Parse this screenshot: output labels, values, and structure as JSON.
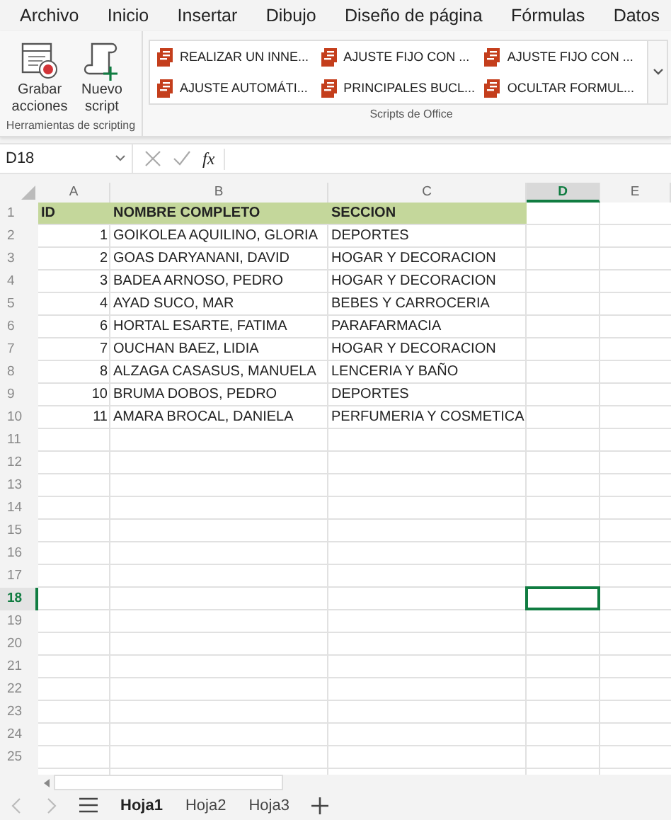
{
  "menu_tabs": [
    "Archivo",
    "Inicio",
    "Insertar",
    "Dibujo",
    "Diseño de página",
    "Fórmulas",
    "Datos"
  ],
  "ribbon": {
    "groups": [
      {
        "kind": "tools",
        "label": "Herramientas de scripting",
        "buttons": [
          {
            "label": "Grabar acciones",
            "kind": "record"
          },
          {
            "label": "Nuevo script",
            "kind": "new"
          }
        ]
      },
      {
        "kind": "scripts",
        "label": "Scripts de Office",
        "scripts": [
          "REALIZAR UN INNE...",
          "AJUSTE FIJO CON ...",
          "AJUSTE FIJO CON ...",
          "AJUSTE AUTOMÁTI...",
          "PRINCIPALES BUCL...",
          "OCULTAR FORMUL..."
        ]
      }
    ]
  },
  "formula_bar": {
    "name_box": "D18",
    "fx": "fx"
  },
  "sheet": {
    "columns": [
      {
        "label": "A",
        "selected": false
      },
      {
        "label": "B",
        "selected": false
      },
      {
        "label": "C",
        "selected": false
      },
      {
        "label": "D",
        "selected": true
      },
      {
        "label": "E",
        "selected": false
      }
    ],
    "rows": [
      {
        "label": "1",
        "selected": false,
        "kind": "header",
        "cells": [
          "ID",
          "NOMBRE COMPLETO",
          "SECCION"
        ]
      },
      {
        "label": "2",
        "selected": false,
        "kind": "data",
        "cells": [
          "1",
          "GOIKOLEA AQUILINO, GLORIA",
          "DEPORTES"
        ]
      },
      {
        "label": "3",
        "selected": false,
        "kind": "data",
        "cells": [
          "2",
          "GOAS DARYANANI, DAVID",
          "HOGAR Y DECORACION"
        ]
      },
      {
        "label": "4",
        "selected": false,
        "kind": "data",
        "cells": [
          "3",
          "BADEA ARNOSO, PEDRO",
          "HOGAR Y DECORACION"
        ]
      },
      {
        "label": "5",
        "selected": false,
        "kind": "data",
        "cells": [
          "4",
          "AYAD SUCO, MAR",
          "BEBES Y CARROCERIA"
        ]
      },
      {
        "label": "6",
        "selected": false,
        "kind": "data",
        "cells": [
          "6",
          "HORTAL ESARTE, FATIMA",
          "PARAFARMACIA"
        ]
      },
      {
        "label": "7",
        "selected": false,
        "kind": "data",
        "cells": [
          "7",
          "OUCHAN BAEZ, LIDIA",
          "HOGAR Y DECORACION"
        ]
      },
      {
        "label": "8",
        "selected": false,
        "kind": "data",
        "cells": [
          "8",
          "ALZAGA CASASUS, MANUELA",
          "LENCERIA Y BAÑO"
        ]
      },
      {
        "label": "9",
        "selected": false,
        "kind": "data",
        "cells": [
          "10",
          "BRUMA DOBOS, PEDRO",
          "DEPORTES"
        ]
      },
      {
        "label": "10",
        "selected": false,
        "kind": "data",
        "cells": [
          "11",
          "AMARA BROCAL, DANIELA",
          "PERFUMERIA Y COSMETICA"
        ]
      },
      {
        "label": "11",
        "selected": false,
        "kind": "data"
      },
      {
        "label": "12",
        "selected": false,
        "kind": "data"
      },
      {
        "label": "13",
        "selected": false,
        "kind": "data"
      },
      {
        "label": "14",
        "selected": false,
        "kind": "data"
      },
      {
        "label": "15",
        "selected": false,
        "kind": "data"
      },
      {
        "label": "16",
        "selected": false,
        "kind": "data"
      },
      {
        "label": "17",
        "selected": false,
        "kind": "data"
      },
      {
        "label": "18",
        "selected": true,
        "kind": "data"
      },
      {
        "label": "19",
        "selected": false,
        "kind": "data"
      },
      {
        "label": "20",
        "selected": false,
        "kind": "data"
      },
      {
        "label": "21",
        "selected": false,
        "kind": "data"
      },
      {
        "label": "22",
        "selected": false,
        "kind": "data"
      },
      {
        "label": "23",
        "selected": false,
        "kind": "data"
      },
      {
        "label": "24",
        "selected": false,
        "kind": "data"
      },
      {
        "label": "25",
        "selected": false,
        "kind": "data"
      }
    ]
  },
  "sheet_tabs": [
    {
      "label": "Hoja1",
      "selected": true
    },
    {
      "label": "Hoja2",
      "selected": false
    },
    {
      "label": "Hoja3",
      "selected": false
    }
  ]
}
